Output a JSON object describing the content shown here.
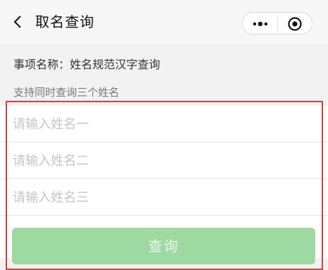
{
  "navbar": {
    "title": "取名查询",
    "back_icon": "chevron-left-icon",
    "more_icon": "more-dots-icon",
    "close_icon": "target-circle-icon"
  },
  "info": {
    "item_name": "事项名称：姓名规范汉字查询",
    "hint": "支持同时查询三个姓名"
  },
  "form": {
    "inputs": [
      {
        "placeholder": "请输入姓名一",
        "value": ""
      },
      {
        "placeholder": "请输入姓名二",
        "value": ""
      },
      {
        "placeholder": "请输入姓名三",
        "value": ""
      }
    ],
    "submit_label": "查询"
  },
  "colors": {
    "button_bg": "#9fd9a2",
    "highlight_border": "#cf4240"
  }
}
